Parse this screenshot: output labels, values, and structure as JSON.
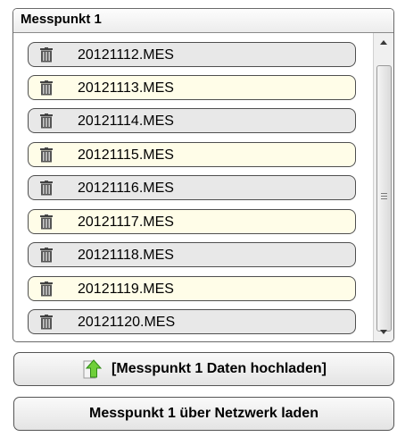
{
  "panel": {
    "title": "Messpunkt 1",
    "files": [
      {
        "name": "20121112.MES"
      },
      {
        "name": "20121113.MES"
      },
      {
        "name": "20121114.MES"
      },
      {
        "name": "20121115.MES"
      },
      {
        "name": "20121116.MES"
      },
      {
        "name": "20121117.MES"
      },
      {
        "name": "20121118.MES"
      },
      {
        "name": "20121119.MES"
      },
      {
        "name": "20121120.MES"
      }
    ],
    "item_icon": "trash-icon"
  },
  "buttons": {
    "upload_label": "[Messpunkt 1 Daten hochladen]",
    "upload_icon": "upload-arrow-icon",
    "network_label": "Messpunkt 1 über Netzwerk laden"
  },
  "colors": {
    "item_gray": "#e8e8e8",
    "item_cream": "#fffde8",
    "upload_arrow": "#6fcf3a"
  }
}
